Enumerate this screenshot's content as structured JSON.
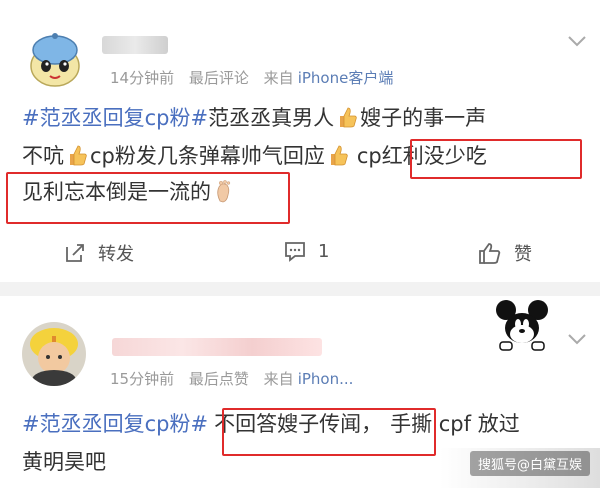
{
  "post1": {
    "meta": {
      "time": "14分钟前",
      "kind": "最后评论",
      "from": "来自",
      "source": "iPhone客户端"
    },
    "line1": {
      "topic": "#范丞丞回复cp粉#",
      "text_a": "范丞丞真男人",
      "text_b": "嫂子的事一声"
    },
    "line2": {
      "text_a": "不吭",
      "text_b": "cp粉发几条弹幕帅气回应",
      "text_c": "cp红利没少吃"
    },
    "line3": {
      "text_a": "见利忘本倒是一流的"
    },
    "actions": {
      "repost": "转发",
      "comment_count": "1",
      "like": "赞"
    }
  },
  "post2": {
    "meta": {
      "time": "15分钟前",
      "kind": "最后点赞",
      "from": "来自",
      "source": "iPhon..."
    },
    "line1": {
      "topic": "#范丞丞回复cp粉#",
      "text_a": "不回答嫂子传闻，",
      "text_b": "手撕 cpf 放过"
    },
    "line2": {
      "text_a": "黄明昊吧"
    }
  },
  "watermark": "搜狐号@白黛互娱",
  "colors": {
    "topic": "#4a6fbf",
    "highlight_box": "#e02b2b",
    "source_link": "#5b7db5"
  },
  "icons": [
    "avatar-mascot",
    "avatar-yellow-hat",
    "chevron-down-icon",
    "thumbs-up-emoji",
    "bare-foot-emoji",
    "share-icon",
    "comment-icon",
    "like-icon",
    "mickey-sticker"
  ]
}
